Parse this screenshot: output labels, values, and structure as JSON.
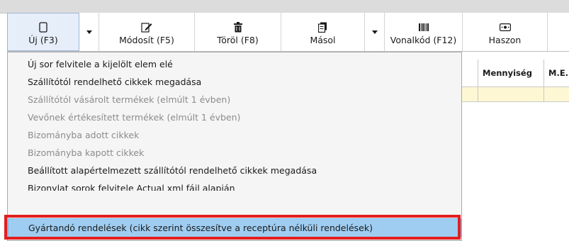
{
  "toolbar": {
    "new_label": "Új (F3)",
    "modify_label": "Módosít (F5)",
    "delete_label": "Töröl (F8)",
    "copy_label": "Másol",
    "barcode_label": "Vonalkód (F12)",
    "profit_label": "Haszon"
  },
  "grid": {
    "headers": [
      "Mennyiség",
      "M.E."
    ]
  },
  "menu": {
    "items": [
      {
        "label": "Új sor felvitele a kijelölt elem elé",
        "enabled": true
      },
      {
        "label": "Szállítótól rendelhető cikkek megadása",
        "enabled": true
      },
      {
        "label": "Szállítótól vásárolt termékek (elmúlt 1 évben)",
        "enabled": false
      },
      {
        "label": "Vevőnek értékesített termékek (elmúlt 1 évben)",
        "enabled": false
      },
      {
        "label": "Bizományba adott cikkek",
        "enabled": false
      },
      {
        "label": "Bizományba kapott cikkek",
        "enabled": false
      },
      {
        "label": "Beállított alapértelmezett szállítótól rendelhető cikkek megadása",
        "enabled": true
      },
      {
        "label": "Bizonylat sorok felvitele Actual xml fájl alapján",
        "enabled": true
      },
      {
        "label": "Gyártandó rendelések (cikk szerint összesítve a receptúra nélküli rendelések)",
        "enabled": true,
        "highlighted": true
      }
    ]
  },
  "colors": {
    "highlight": "#9fcdf1",
    "annotation_box": "#e21f1f",
    "grid_row": "#fdf8d3"
  }
}
